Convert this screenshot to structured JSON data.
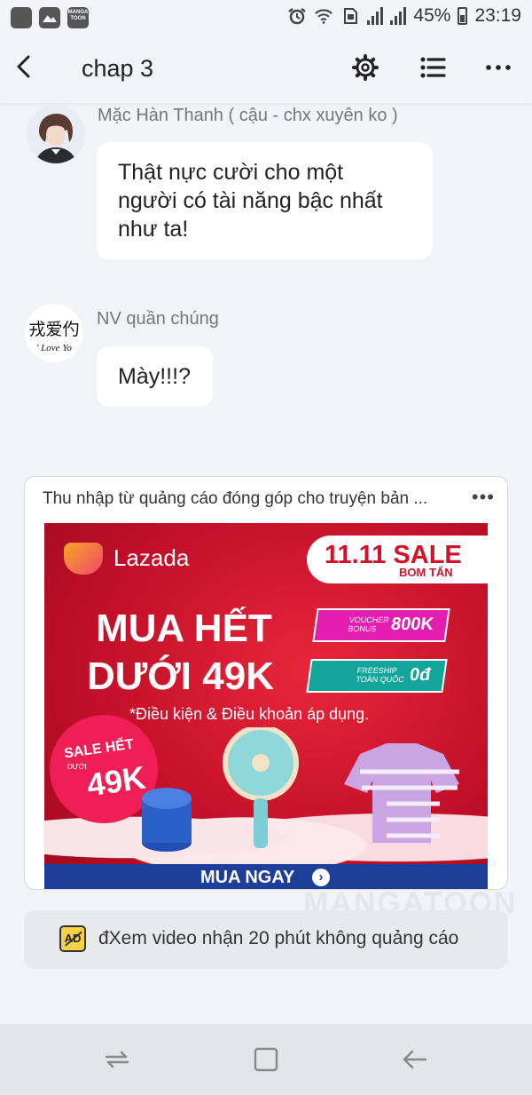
{
  "status_bar": {
    "battery": "45%",
    "time": "23:19",
    "app_badge": "MANGA TOON"
  },
  "header": {
    "title": "chap 3"
  },
  "messages": [
    {
      "author": "Mặc Hàn Thanh ( cậu - chx xuyên ko )",
      "lines": [
        "Thật nực cười cho một",
        "người có tài năng bậc nhất",
        "như ta!"
      ]
    },
    {
      "author": "NV quần chúng",
      "avatar_text_top": "戎爱仢",
      "avatar_text_bottom": "' Love Yo",
      "lines": [
        "Mày!!!?"
      ]
    }
  ],
  "ad": {
    "title": "Thu nhập từ quảng cáo đóng góp cho truyện bản ...",
    "more": "•••",
    "banner": {
      "brand": "Lazada",
      "sale_top": "11.11 SALE",
      "sale_bottom": "BOM TẤN",
      "headline_1": "MUA HẾT",
      "headline_2": "DƯỚI 49K",
      "voucher_small": "VOUCHER BONUS",
      "voucher_value": "800K",
      "freeship_small": "FREESHIP TOÀN QUỐC",
      "freeship_value": "0đ",
      "terms": "*Điều kiện & Điều khoản áp dụng.",
      "badge_line1": "SALE HẾT",
      "badge_line2": "DƯỚI",
      "badge_value": "49K",
      "cta": "MUA NGAY"
    }
  },
  "watermark": "MANGATOON",
  "video_bar": {
    "icon_text": "AD",
    "label": "đXem video nhận 20 phút không quảng cáo"
  },
  "colors": {
    "background": "#f2f3f7",
    "banner_red": "#c9142d",
    "cta_blue": "#1d3f9a"
  }
}
